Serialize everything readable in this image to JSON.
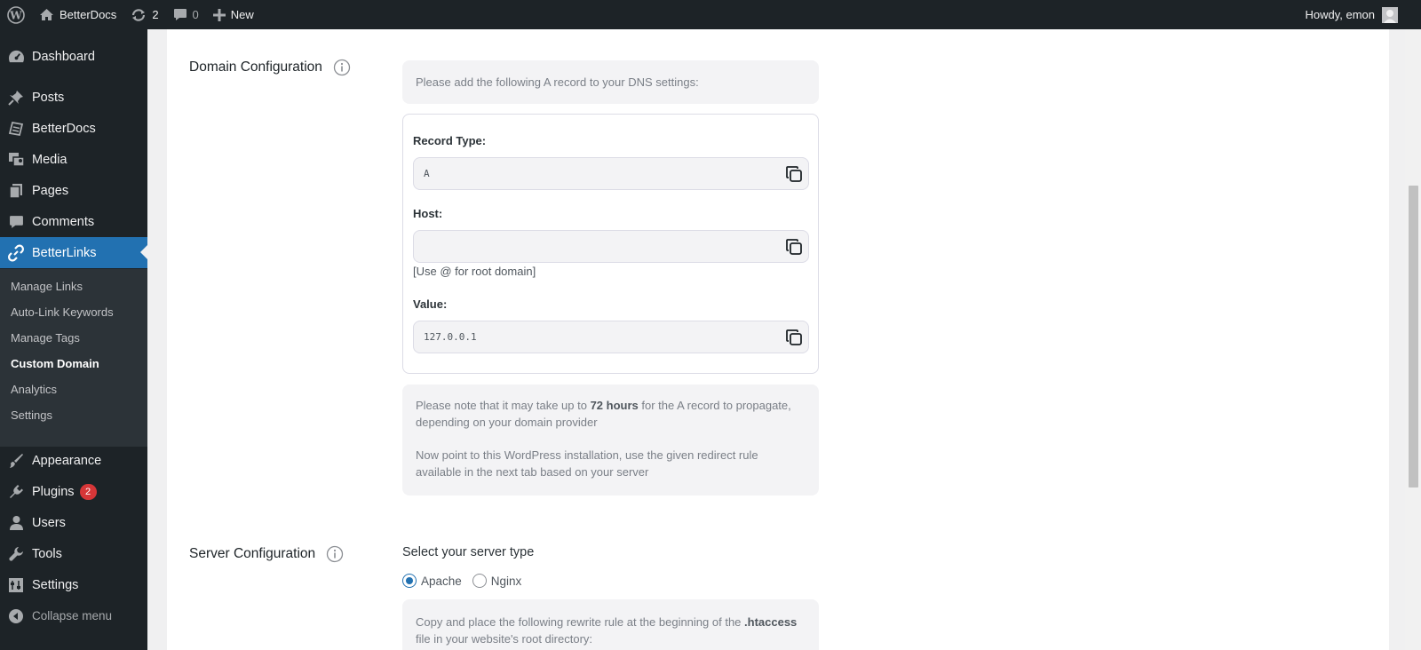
{
  "adminbar": {
    "wp_logo": "wordpress-icon",
    "site_name": "BetterDocs",
    "updates_count": "2",
    "comments_count": "0",
    "new_label": "New",
    "howdy": "Howdy, emon"
  },
  "sidebar": {
    "items": [
      {
        "label": "Dashboard",
        "icon": "dashboard-icon"
      },
      {
        "label": "Posts",
        "icon": "pin-icon"
      },
      {
        "label": "BetterDocs",
        "icon": "docs-icon"
      },
      {
        "label": "Media",
        "icon": "media-icon"
      },
      {
        "label": "Pages",
        "icon": "pages-icon"
      },
      {
        "label": "Comments",
        "icon": "comment-icon"
      },
      {
        "label": "BetterLinks",
        "icon": "link-icon"
      },
      {
        "label": "Appearance",
        "icon": "brush-icon"
      },
      {
        "label": "Plugins",
        "icon": "plugin-icon",
        "badge": "2"
      },
      {
        "label": "Users",
        "icon": "user-icon"
      },
      {
        "label": "Tools",
        "icon": "wrench-icon"
      },
      {
        "label": "Settings",
        "icon": "settings-icon"
      }
    ],
    "submenu": [
      "Manage Links",
      "Auto-Link Keywords",
      "Manage Tags",
      "Custom Domain",
      "Analytics",
      "Settings"
    ],
    "collapse_label": "Collapse menu",
    "active_color": "#2271b1"
  },
  "domain": {
    "label": "Domain Configuration",
    "intro": "Please add the following A record to your DNS settings:",
    "record_type_label": "Record Type:",
    "record_type_value": "A",
    "host_label": "Host:",
    "host_value": "",
    "host_hint": "[Use @ for root domain]",
    "value_label": "Value:",
    "value_value": "127.0.0.1",
    "note_before": "Please note that it may take up to ",
    "note_bold": "72 hours",
    "note_after": " for the A record to propagate, depending on your domain provider",
    "note2": "Now point to this WordPress installation, use the given redirect rule available in the next tab based on your server"
  },
  "server": {
    "label": "Server Configuration",
    "select_title": "Select your server type",
    "options": [
      "Apache",
      "Nginx"
    ],
    "selected": "Apache",
    "rule_before": "Copy and place the following rewrite rule at the beginning of the ",
    "rule_bold": ".htaccess",
    "rule_after": " file in your website's root directory:"
  }
}
